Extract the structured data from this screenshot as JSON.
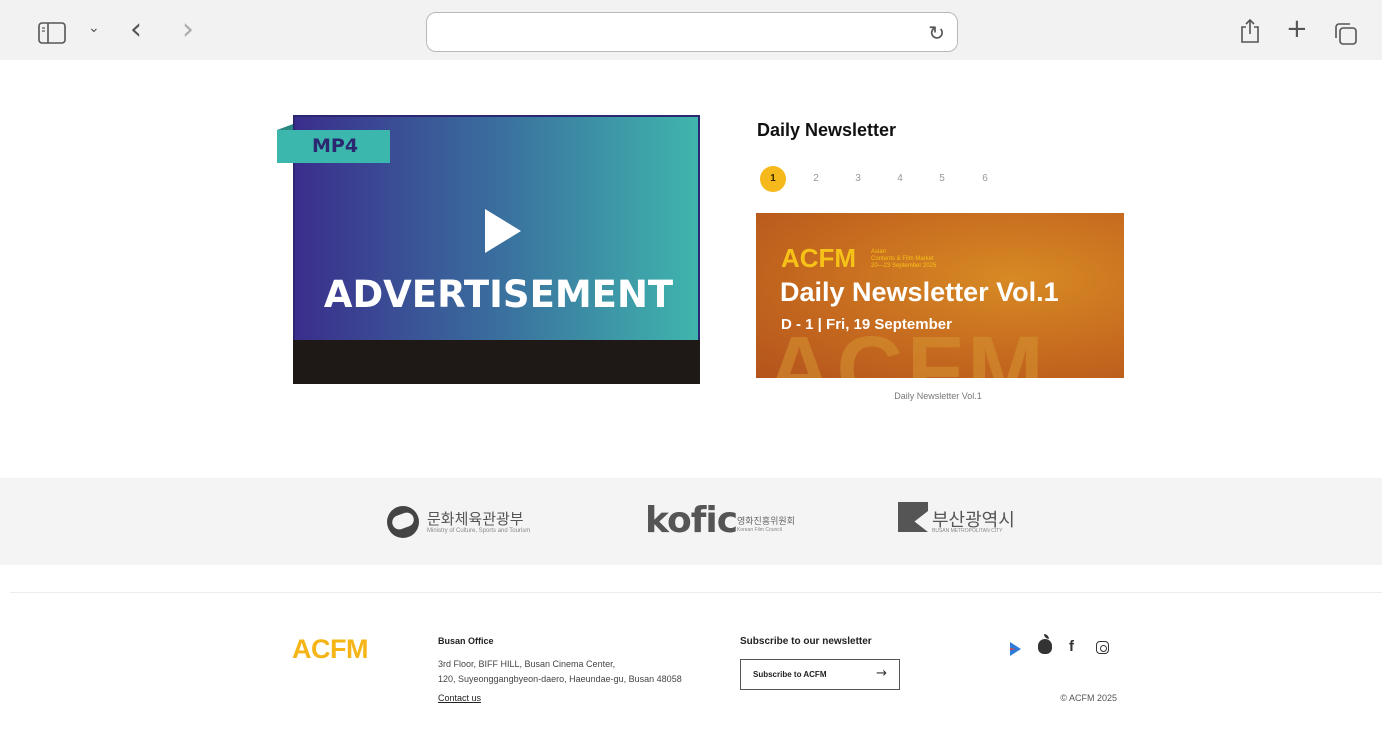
{
  "browser": {
    "sidebar_icon": "sidebar-icon",
    "chevron": "⌄",
    "back": "‹",
    "forward": "›",
    "reload": "↻",
    "share": "⎙",
    "new_tab": "+",
    "tabs": "⧉",
    "url": ""
  },
  "ad": {
    "tag": "MP4",
    "text": "ADVERTISEMENT"
  },
  "newsletter": {
    "title": "Daily Newsletter",
    "pages": [
      "1",
      "2",
      "3",
      "4",
      "5",
      "6"
    ],
    "active_page": "1",
    "banner": {
      "brand": "ACFM",
      "brand_sub_1": "Asian",
      "brand_sub_2": "Contents & Film Market",
      "brand_sub_3": "20—23 September 2025",
      "headline": "Daily Newsletter Vol.1",
      "dateline": "D - 1  |  Fri, 19 September",
      "bg_word": "ACFM"
    },
    "caption": "Daily Newsletter Vol.1"
  },
  "partners": {
    "ministry_name": "문화체육관광부",
    "ministry_sub": "Ministry of Culture, Sports and Tourism",
    "kofic": "kofic",
    "kofic_kr": "영화진흥위원회",
    "kofic_sub": "Korean Film Council",
    "busan_name": "부산광역시",
    "busan_sub": "BUSAN METROPOLITAN CITY"
  },
  "footer": {
    "logo": "ACFM",
    "office_title": "Busan Office",
    "address_line1": "3rd Floor, BIFF HILL, Busan Cinema Center,",
    "address_line2": "120, Suyeonggangbyeon-daero, Haeundae-gu, Busan 48058",
    "contact": "Contact us",
    "subscribe_label": "Subscribe to our newsletter",
    "subscribe_button": "Subscribe to ACFM",
    "subscribe_arrow": "→",
    "facebook": "f",
    "copyright": "© ACFM 2025"
  },
  "colors": {
    "accent_yellow": "#f5b517",
    "ad_teal": "#3bb7ae",
    "ad_indigo": "#2b2770"
  }
}
